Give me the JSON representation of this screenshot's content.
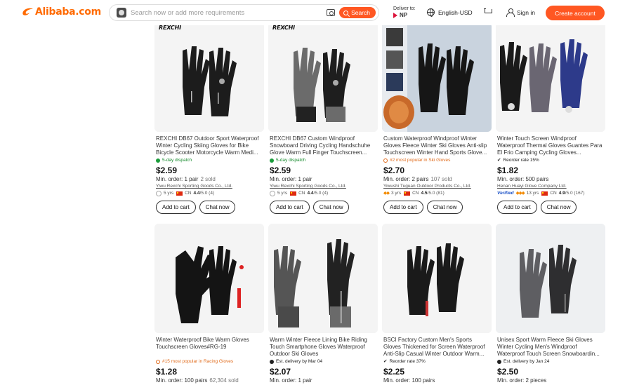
{
  "header": {
    "logo_text": "Alibaba.com",
    "search_placeholder": "Search now or add more requirements",
    "search_button": "Search",
    "deliver_label": "Deliver to:",
    "deliver_country": "NP",
    "language": "English-USD",
    "signin": "Sign in",
    "create_account": "Create account",
    "icons": [
      "alibaba-logo-icon",
      "camera-icon",
      "search-icon",
      "globe-icon",
      "cart-icon",
      "user-icon"
    ],
    "accent_color": "#ff5722"
  },
  "products": [
    {
      "brand_mark": "REXCHI",
      "title": "REXCHI DB67 Outdoor Sport Waterproof Winter Cycling Skiing Gloves for Bike Bicycle Scooter Motorcycle Warm Medi...",
      "tag": "5-day dispatch",
      "price": "$2.59",
      "moq": "Min. order: 1 pair",
      "sold": "2 sold",
      "supplier": "Yiwu Rexchi Sporting Goods Co., Ltd.",
      "years": "5 yrs",
      "country": "CN",
      "rating": "4.4",
      "rating_suffix": "/5.0 (4)",
      "add_to_cart": "Add to cart",
      "chat": "Chat now"
    },
    {
      "brand_mark": "REXCHI",
      "title": "REXCHI DB67 Custom Windproof Snowboard Driving Cycling Handschuhe Glove Warm Full Finger Touchscreen...",
      "tag": "5-day dispatch",
      "price": "$2.59",
      "moq": "Min. order: 1 pair",
      "sold": "",
      "supplier": "Yiwu Rexchi Sporting Goods Co., Ltd.",
      "years": "5 yrs",
      "country": "CN",
      "rating": "4.4",
      "rating_suffix": "/5.0 (4)",
      "add_to_cart": "Add to cart",
      "chat": "Chat now"
    },
    {
      "title": "Custom Waterproof Windproof Winter Gloves Fleece Winter Ski Gloves Anti-slip Touchscreen Winter Hand Sports Glove...",
      "tag": "#2 most popular in Ski Gloves",
      "price": "$2.70",
      "moq": "Min. order: 2 pairs",
      "sold": "107 sold",
      "supplier": "Yiwushi Tuguan Outdoor Products Co., Ltd.",
      "years": "3 yrs",
      "country": "CN",
      "rating": "4.5",
      "rating_suffix": "/5.0 (81)",
      "add_to_cart": "Add to cart",
      "chat": "Chat now"
    },
    {
      "title": "Winter Touch Screen Windproof Waterproof Thermal Gloves Guantes Para El Frio Camping Cycling Gloves...",
      "tag": "Reorder rate 15%",
      "price": "$1.82",
      "moq": "Min. order: 500 pairs",
      "sold": "",
      "supplier": "Henan Huayi Glove Company Ltd.",
      "verified": "Verified",
      "years": "13 yrs",
      "country": "CN",
      "rating": "4.9",
      "rating_suffix": "/5.0 (167)",
      "add_to_cart": "Add to cart",
      "chat": "Chat now"
    },
    {
      "title": "Winter Waterproof Bike Warm Gloves Touchscreen Gloves#RG-19",
      "tag": "#15 most popular in Racing Gloves",
      "price": "$1.28",
      "moq": "Min. order: 100 pairs",
      "sold": "62,304 sold"
    },
    {
      "title": "Warm Winter Fleece Lining Bike Riding Touch Smartphone Gloves Waterproof Outdoor Ski Gloves",
      "tag": "Est. delivery by Mar 04",
      "price": "$2.07",
      "moq": "Min. order: 1 pair",
      "sold": ""
    },
    {
      "title": "BSCI Factory Custom Men's Sports Gloves Thickened for Screen Waterproof Anti-Slip Casual Winter Outdoor Warm...",
      "tag": "Reorder rate 37%",
      "price": "$2.25",
      "moq": "Min. order: 100 pairs",
      "sold": ""
    },
    {
      "title": "Unisex Sport Warm Fleece Ski Gloves Winter Cycling Men's Windproof Waterproof Touch Screen Snowboardin...",
      "tag": "Est. delivery by Jan 24",
      "price": "$2.50",
      "moq": "Min. order: 2 pieces",
      "sold": ""
    }
  ]
}
